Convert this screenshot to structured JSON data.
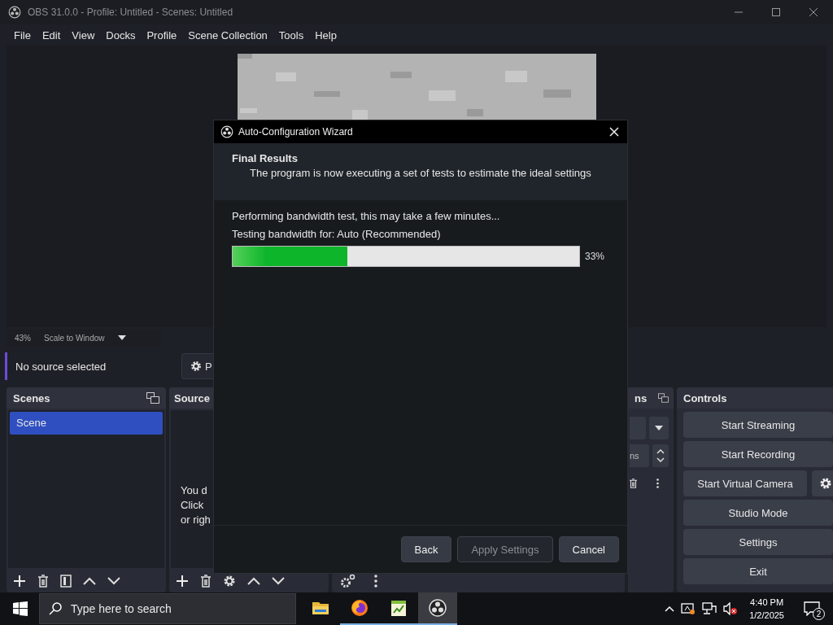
{
  "window": {
    "title": "OBS 31.0.0 - Profile: Untitled - Scenes: Untitled"
  },
  "menu": [
    "File",
    "Edit",
    "View",
    "Docks",
    "Profile",
    "Scene Collection",
    "Tools",
    "Help"
  ],
  "preview": {
    "zoom": "43%",
    "scale_mode": "Scale to Window"
  },
  "context_bar": {
    "label": "No source selected",
    "properties_button": "P"
  },
  "scenes": {
    "title": "Scenes",
    "items": [
      {
        "name": "Scene",
        "selected": true
      }
    ]
  },
  "sources": {
    "title": "Source",
    "empty_hint": [
      "You d",
      "Click",
      "or righ"
    ]
  },
  "transitions": {
    "title": "ns",
    "duration": "ns"
  },
  "controls": {
    "title": "Controls",
    "buttons": [
      {
        "label": "Start Streaming",
        "kind": "wide"
      },
      {
        "label": "Start Recording",
        "kind": "wide"
      },
      {
        "label": "Start Virtual Camera",
        "kind": "with-gear"
      },
      {
        "label": "Studio Mode",
        "kind": "wide"
      },
      {
        "label": "Settings",
        "kind": "wide"
      },
      {
        "label": "Exit",
        "kind": "wide"
      }
    ]
  },
  "dialog": {
    "title": "Auto-Configuration Wizard",
    "heading": "Final Results",
    "subheading": "The program is now executing a set of tests to estimate the ideal settings",
    "status": "Performing bandwidth test, this may take a few minutes...",
    "detail": "Testing bandwidth for: Auto (Recommended)",
    "progress": {
      "level": 0.33,
      "reading": "33%"
    },
    "buttons": [
      {
        "label": "Back",
        "disabled": false
      },
      {
        "label": "Apply Settings",
        "disabled": true
      },
      {
        "label": "Cancel",
        "disabled": false
      }
    ]
  },
  "taskbar": {
    "search_placeholder": "Type here to search",
    "apps": [
      {
        "kind": "folder",
        "running": false,
        "selected": false
      },
      {
        "kind": "browser",
        "running": true,
        "selected": false
      },
      {
        "kind": "notepad",
        "running": true,
        "selected": false
      },
      {
        "kind": "obs",
        "running": true,
        "selected": true
      }
    ],
    "time": "4:40 PM",
    "date": "1/2/2025",
    "notifications": "2"
  }
}
